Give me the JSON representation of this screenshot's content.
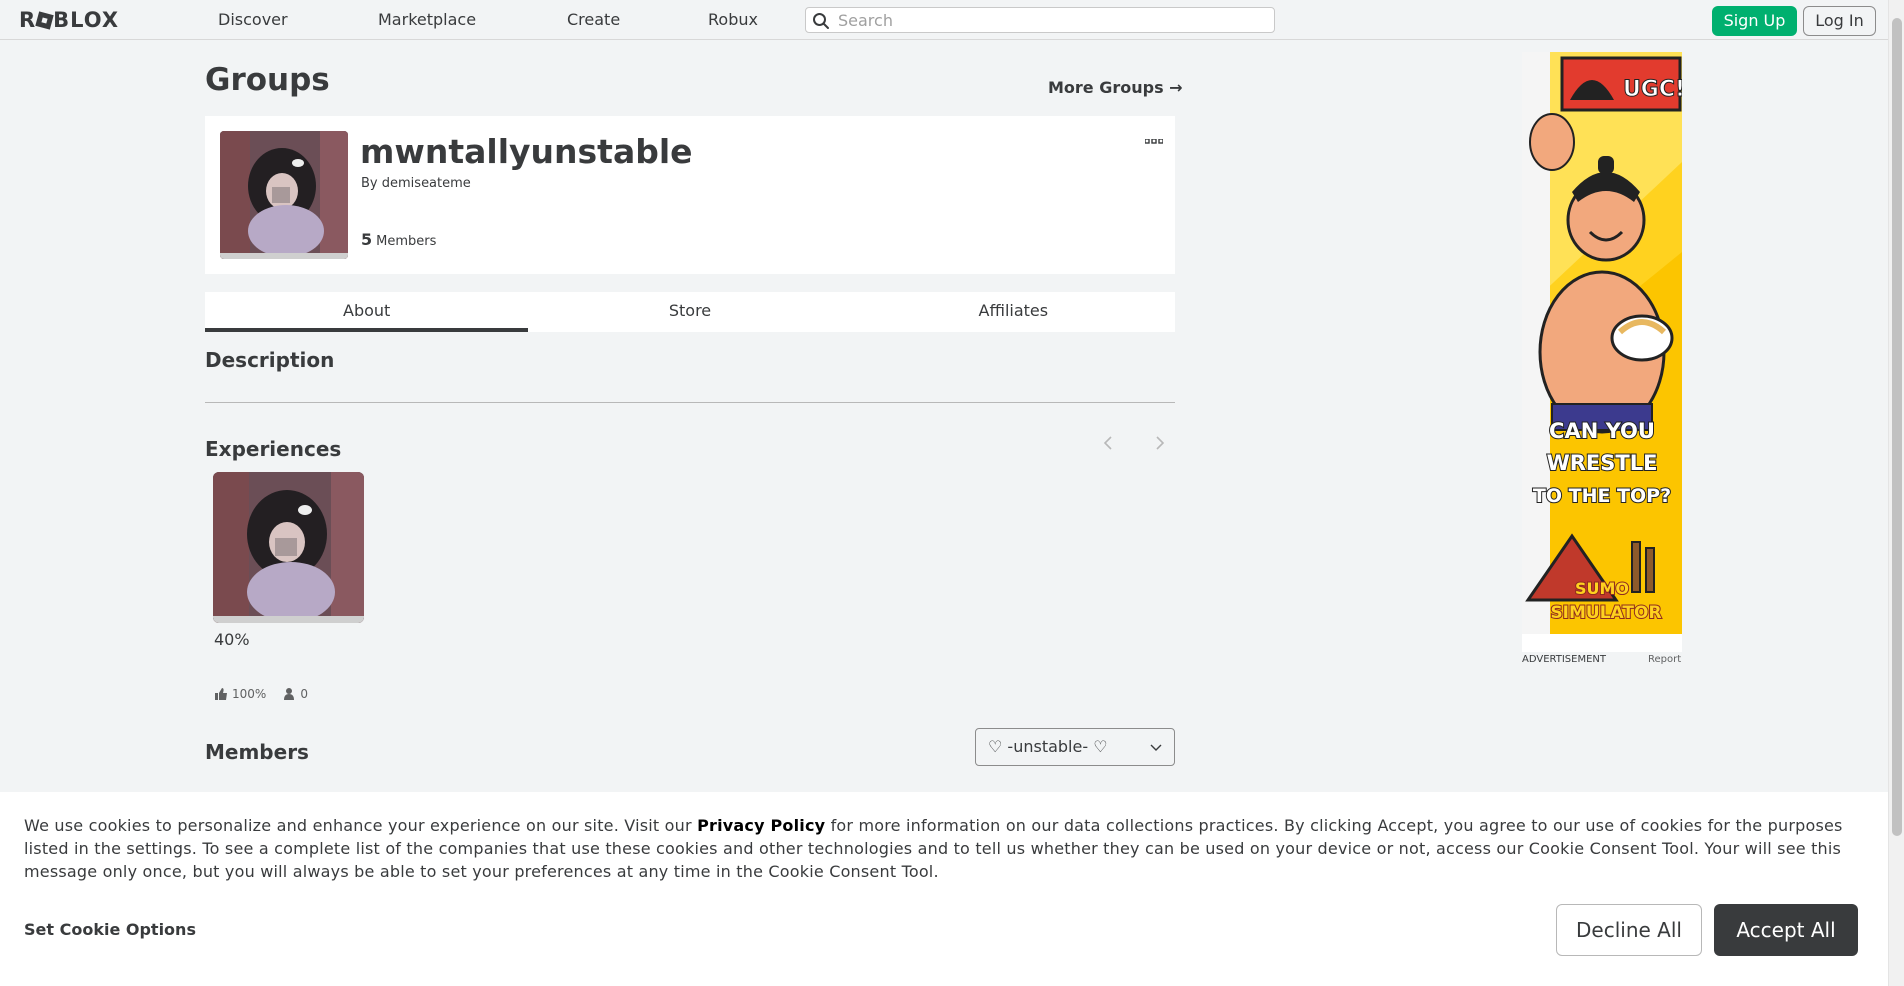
{
  "nav": {
    "logo": "ROBLOX",
    "links": [
      "Discover",
      "Marketplace",
      "Create",
      "Robux"
    ],
    "search_placeholder": "Search",
    "signup_label": "Sign Up",
    "login_label": "Log In"
  },
  "page": {
    "title": "Groups",
    "more_groups": "More Groups →"
  },
  "group": {
    "name": "mwntallyunstable",
    "by_prefix": "By",
    "owner": "demiseateme",
    "member_count": "5",
    "members_label": "Members",
    "menu_icon": "ellipsis-icon"
  },
  "tabs": [
    "About",
    "Store",
    "Affiliates"
  ],
  "sections": {
    "description": "Description",
    "experiences": "Experiences",
    "members": "Members"
  },
  "experience": {
    "rating": "40%",
    "upvote_pct": "100%",
    "players": "0"
  },
  "role_select": {
    "value": "♡ -unstable- ♡"
  },
  "ad": {
    "badge": "UGC!",
    "headline": [
      "CAN YOU",
      "WRESTLE",
      "TO THE TOP?"
    ],
    "brand": [
      "SUMO",
      "SIMULATOR"
    ],
    "label": "ADVERTISEMENT",
    "report": "Report"
  },
  "cookie": {
    "text_before": "We use cookies to personalize and enhance your experience on our site. Visit our ",
    "privacy_link": "Privacy Policy",
    "text_after": " for more information on our data collections practices. By clicking Accept, you agree to our use of cookies for the purposes listed in the settings. To see a complete list of the companies that use these cookies and other technologies and to tell us whether they can be used on your device or not, access our Cookie Consent Tool. Your will see this message only once, but you will always be able to set your preferences at any time in the Cookie Consent Tool.",
    "options_label": "Set Cookie Options",
    "decline_label": "Decline All",
    "accept_label": "Accept All"
  },
  "colors": {
    "accent_green": "#00b06f",
    "text_dark": "#393b3d",
    "background": "#f2f4f5",
    "ad_yellow": "#ffd21f"
  }
}
